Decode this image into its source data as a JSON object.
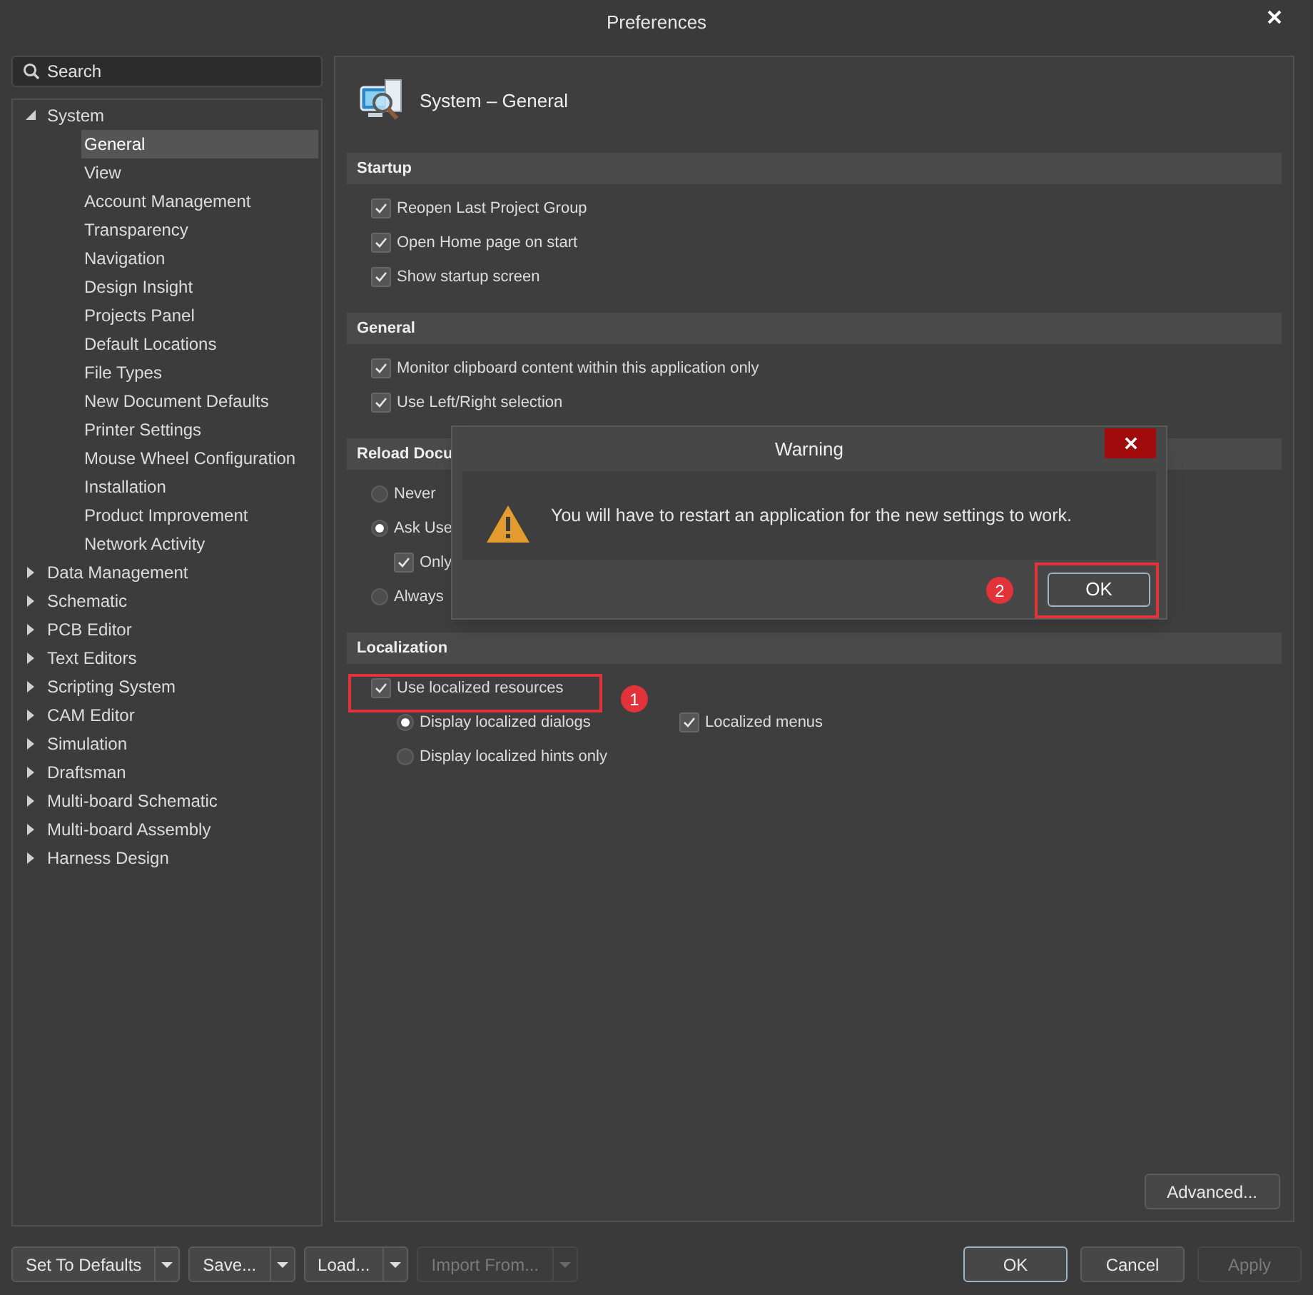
{
  "window": {
    "title": "Preferences"
  },
  "sidebar": {
    "search": {
      "placeholder": "Search"
    },
    "tree": [
      {
        "label": "System",
        "expanded": true,
        "children": [
          {
            "label": "General",
            "selected": true
          },
          {
            "label": "View",
            "selected": false
          },
          {
            "label": "Account Management",
            "selected": false
          },
          {
            "label": "Transparency",
            "selected": false
          },
          {
            "label": "Navigation",
            "selected": false
          },
          {
            "label": "Design Insight",
            "selected": false
          },
          {
            "label": "Projects Panel",
            "selected": false
          },
          {
            "label": "Default Locations",
            "selected": false
          },
          {
            "label": "File Types",
            "selected": false
          },
          {
            "label": "New Document Defaults",
            "selected": false
          },
          {
            "label": "Printer Settings",
            "selected": false
          },
          {
            "label": "Mouse Wheel Configuration",
            "selected": false
          },
          {
            "label": "Installation",
            "selected": false
          },
          {
            "label": "Product Improvement",
            "selected": false
          },
          {
            "label": "Network Activity",
            "selected": false
          }
        ]
      },
      {
        "label": "Data Management",
        "expanded": false
      },
      {
        "label": "Schematic",
        "expanded": false
      },
      {
        "label": "PCB Editor",
        "expanded": false
      },
      {
        "label": "Text Editors",
        "expanded": false
      },
      {
        "label": "Scripting System",
        "expanded": false
      },
      {
        "label": "CAM Editor",
        "expanded": false
      },
      {
        "label": "Simulation",
        "expanded": false
      },
      {
        "label": "Draftsman",
        "expanded": false
      },
      {
        "label": "Multi-board Schematic",
        "expanded": false
      },
      {
        "label": "Multi-board Assembly",
        "expanded": false
      },
      {
        "label": "Harness Design",
        "expanded": false
      }
    ]
  },
  "page": {
    "title": "System – General",
    "sections": [
      {
        "title": "Startup",
        "options": [
          {
            "kind": "checkbox",
            "label": "Reopen Last Project Group",
            "checked": true
          },
          {
            "kind": "checkbox",
            "label": "Open Home page on start",
            "checked": true
          },
          {
            "kind": "checkbox",
            "label": "Show startup screen",
            "checked": true
          }
        ]
      },
      {
        "title": "General",
        "options": [
          {
            "kind": "checkbox",
            "label": "Monitor clipboard content within this application only",
            "checked": true
          },
          {
            "kind": "checkbox",
            "label": "Use Left/Right selection",
            "checked": true
          }
        ]
      },
      {
        "title": "Reload Docu",
        "options": [
          {
            "kind": "radio",
            "label": "Never",
            "selected": false
          },
          {
            "kind": "radio",
            "label": "Ask Use",
            "selected": true,
            "children": [
              {
                "kind": "checkbox",
                "label": "Only",
                "checked": true
              }
            ]
          },
          {
            "kind": "radio",
            "label": "Always",
            "selected": false
          }
        ]
      },
      {
        "title": "Localization",
        "options": [
          {
            "kind": "checkbox",
            "label": "Use localized resources",
            "checked": true,
            "children": [
              {
                "kind": "radio",
                "label": "Display localized dialogs",
                "selected": true
              },
              {
                "kind": "radio",
                "label": "Display localized hints only",
                "selected": false
              }
            ]
          }
        ],
        "side_options": [
          {
            "kind": "checkbox",
            "label": "Localized menus",
            "checked": true
          }
        ]
      }
    ],
    "advanced_button": "Advanced..."
  },
  "footer": {
    "left_buttons": [
      {
        "label": "Set To Defaults",
        "disabled": false
      },
      {
        "label": "Save...",
        "disabled": false
      },
      {
        "label": "Load...",
        "disabled": false
      },
      {
        "label": "Import From...",
        "disabled": true
      }
    ],
    "right_buttons": [
      {
        "label": "OK",
        "disabled": false,
        "focused": true
      },
      {
        "label": "Cancel",
        "disabled": false,
        "focused": false
      },
      {
        "label": "Apply",
        "disabled": true,
        "focused": false
      }
    ]
  },
  "dialog": {
    "title": "Warning",
    "message": "You will have to restart an application for the new settings to work.",
    "button": "OK"
  },
  "annotations": [
    {
      "label": "1"
    },
    {
      "label": "2"
    }
  ]
}
